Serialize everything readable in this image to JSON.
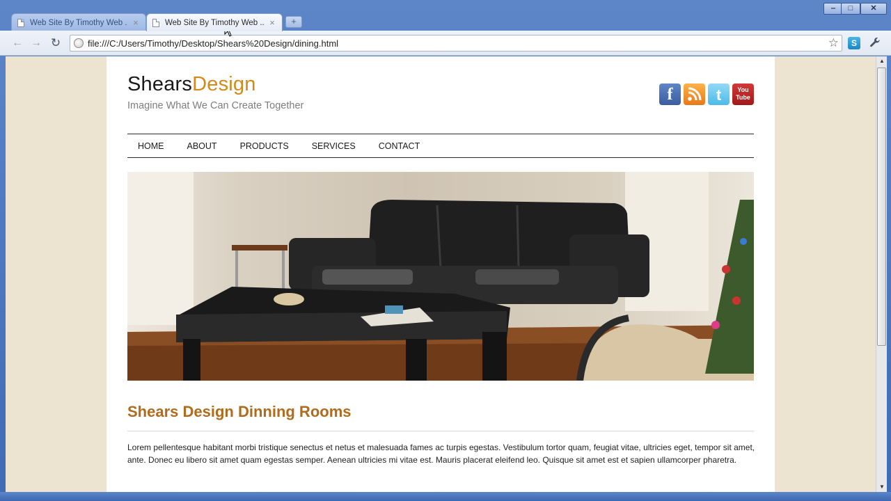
{
  "browser": {
    "tabs": [
      {
        "title": "Web Site By Timothy Web ...",
        "close": "×",
        "active": false
      },
      {
        "title": "Web Site By Timothy Web ...",
        "close": "×",
        "active": true
      }
    ],
    "new_tab": "+",
    "window_controls": {
      "minimize": "‒",
      "maximize": "□",
      "close": "✕"
    },
    "nav": {
      "back": "←",
      "forward": "→",
      "reload": "↻"
    },
    "url": "file:///C:/Users/Timothy/Desktop/Shears%20Design/dining.html",
    "bookmark_star": "☆",
    "extension_label": "S",
    "wrench": "🔧"
  },
  "site": {
    "logo_part1": "Shears",
    "logo_part2": "Design",
    "tagline": "Imagine What We Can Create Together",
    "social": [
      {
        "name": "facebook",
        "glyph": "f"
      },
      {
        "name": "rss",
        "glyph": ")))"
      },
      {
        "name": "twitter",
        "glyph": "t"
      },
      {
        "name": "youtube",
        "glyph_top": "You",
        "glyph_bottom": "Tube"
      }
    ],
    "nav": [
      "HOME",
      "ABOUT",
      "PRODUCTS",
      "SERVICES",
      "CONTACT"
    ],
    "heading": "Shears Design Dinning Rooms",
    "paragraph": "Lorem pellentesque habitant morbi tristique senectus et netus et malesuada fames ac turpis egestas. Vestibulum tortor quam, feugiat vitae, ultricies eget, tempor sit amet, ante. Donec eu libero sit amet quam egestas semper. Aenean ultricies mi vitae est. Mauris placerat eleifend leo. Quisque sit amet est et sapien ullamcorper pharetra."
  },
  "colors": {
    "logo_accent": "#d38a1a",
    "heading": "#b06b1c",
    "page_background": "#ece3d0"
  }
}
